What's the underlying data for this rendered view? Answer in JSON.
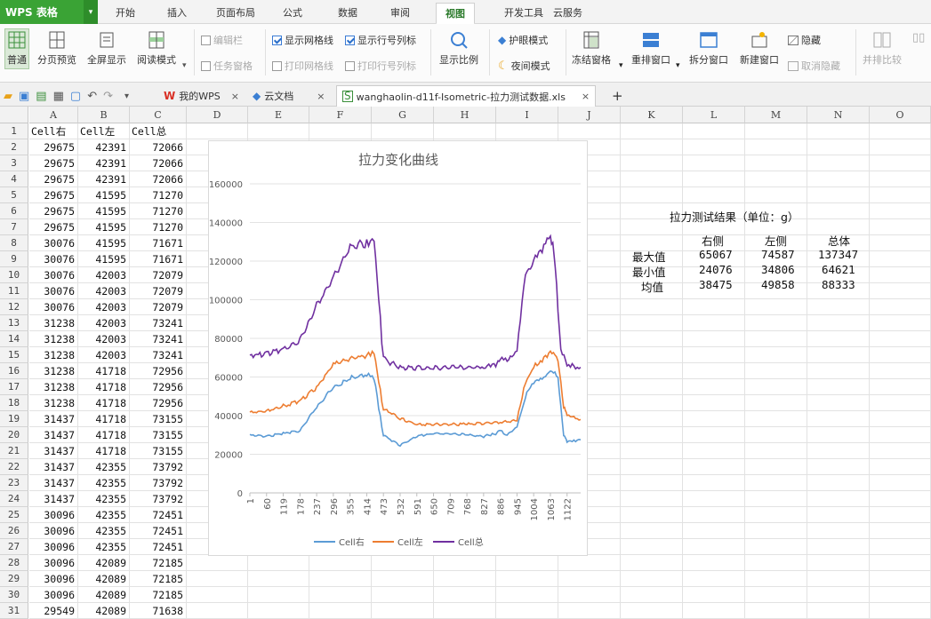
{
  "app": {
    "name": "WPS 表格"
  },
  "menu_tabs": [
    "开始",
    "插入",
    "页面布局",
    "公式",
    "数据",
    "审阅",
    "视图",
    "开发工具",
    "云服务"
  ],
  "active_menu_tab": "视图",
  "ribbon": {
    "normal": "普通",
    "page_break": "分页预览",
    "fullscreen": "全屏显示",
    "reading": "阅读模式",
    "edit_bar": "编辑栏",
    "task_pane": "任务窗格",
    "show_gridlines": "显示网格线",
    "print_gridlines": "打印网格线",
    "show_headers": "显示行号列标",
    "print_headers": "打印行号列标",
    "zoom": "显示比例",
    "eye_mode": "护眼模式",
    "night_mode": "夜间模式",
    "freeze": "冻结窗格",
    "rearrange": "重排窗口",
    "split": "拆分窗口",
    "new_window": "新建窗口",
    "hide": "隐藏",
    "unhide": "取消隐藏",
    "side_by_side": "并排比较"
  },
  "doc_tabs": {
    "my_wps": "我的WPS",
    "cloud_docs": "云文档",
    "file": "wanghaolin-d11f-Isometric-拉力测试数据.xls"
  },
  "columns": [
    "A",
    "B",
    "C",
    "D",
    "E",
    "F",
    "G",
    "H",
    "I",
    "J",
    "K",
    "L",
    "M",
    "N",
    "O"
  ],
  "header_row": [
    "Cell右",
    "Cell左",
    "Cell总"
  ],
  "rows": [
    [
      29675,
      42391,
      72066
    ],
    [
      29675,
      42391,
      72066
    ],
    [
      29675,
      42391,
      72066
    ],
    [
      29675,
      41595,
      71270
    ],
    [
      29675,
      41595,
      71270
    ],
    [
      29675,
      41595,
      71270
    ],
    [
      30076,
      41595,
      71671
    ],
    [
      30076,
      41595,
      71671
    ],
    [
      30076,
      42003,
      72079
    ],
    [
      30076,
      42003,
      72079
    ],
    [
      30076,
      42003,
      72079
    ],
    [
      31238,
      42003,
      73241
    ],
    [
      31238,
      42003,
      73241
    ],
    [
      31238,
      42003,
      73241
    ],
    [
      31238,
      41718,
      72956
    ],
    [
      31238,
      41718,
      72956
    ],
    [
      31238,
      41718,
      72956
    ],
    [
      31437,
      41718,
      73155
    ],
    [
      31437,
      41718,
      73155
    ],
    [
      31437,
      41718,
      73155
    ],
    [
      31437,
      42355,
      73792
    ],
    [
      31437,
      42355,
      73792
    ],
    [
      31437,
      42355,
      73792
    ],
    [
      30096,
      42355,
      72451
    ],
    [
      30096,
      42355,
      72451
    ],
    [
      30096,
      42355,
      72451
    ],
    [
      30096,
      42089,
      72185
    ],
    [
      30096,
      42089,
      72185
    ],
    [
      30096,
      42089,
      72185
    ],
    [
      29549,
      42089,
      71638
    ]
  ],
  "results": {
    "title": "拉力测试结果（单位：g）",
    "headers": [
      "右侧",
      "左侧",
      "总体"
    ],
    "rows": [
      {
        "label": "最大值",
        "values": [
          65067,
          74587,
          137347
        ]
      },
      {
        "label": "最小值",
        "values": [
          24076,
          34806,
          64621
        ]
      },
      {
        "label": "均值",
        "values": [
          38475,
          49858,
          88333
        ]
      }
    ]
  },
  "chart_data": {
    "type": "line",
    "title": "拉力变化曲线",
    "ylim": [
      0,
      160000
    ],
    "yticks": [
      0,
      20000,
      40000,
      60000,
      80000,
      100000,
      120000,
      140000,
      160000
    ],
    "xtick_labels": [
      "1",
      "60",
      "119",
      "178",
      "237",
      "296",
      "355",
      "414",
      "473",
      "532",
      "591",
      "650",
      "709",
      "768",
      "827",
      "886",
      "945",
      "1004",
      "1063",
      "1122"
    ],
    "x_range": [
      1,
      1170
    ],
    "legend_position": "bottom",
    "series": [
      {
        "name": "Cell右",
        "color": "#5b9bd5",
        "points": [
          [
            1,
            30000
          ],
          [
            60,
            29700
          ],
          [
            119,
            31000
          ],
          [
            178,
            32500
          ],
          [
            237,
            45000
          ],
          [
            296,
            55000
          ],
          [
            355,
            60000
          ],
          [
            414,
            62000
          ],
          [
            440,
            60000
          ],
          [
            473,
            30000
          ],
          [
            532,
            25000
          ],
          [
            591,
            29500
          ],
          [
            650,
            31000
          ],
          [
            709,
            31000
          ],
          [
            768,
            30500
          ],
          [
            827,
            29500
          ],
          [
            870,
            31000
          ],
          [
            886,
            33000
          ],
          [
            910,
            30000
          ],
          [
            945,
            35000
          ],
          [
            980,
            52000
          ],
          [
            1004,
            58000
          ],
          [
            1040,
            60000
          ],
          [
            1063,
            65000
          ],
          [
            1090,
            60000
          ],
          [
            1110,
            30000
          ],
          [
            1122,
            27000
          ],
          [
            1170,
            27500
          ]
        ]
      },
      {
        "name": "Cell左",
        "color": "#ed7d31",
        "points": [
          [
            1,
            42000
          ],
          [
            60,
            43000
          ],
          [
            119,
            45500
          ],
          [
            178,
            48000
          ],
          [
            237,
            55000
          ],
          [
            296,
            67000
          ],
          [
            355,
            70000
          ],
          [
            414,
            72000
          ],
          [
            440,
            73000
          ],
          [
            473,
            44000
          ],
          [
            532,
            39000
          ],
          [
            591,
            36000
          ],
          [
            650,
            35800
          ],
          [
            709,
            35800
          ],
          [
            768,
            36000
          ],
          [
            827,
            36200
          ],
          [
            886,
            37000
          ],
          [
            945,
            38000
          ],
          [
            975,
            58000
          ],
          [
            1004,
            66000
          ],
          [
            1040,
            70000
          ],
          [
            1063,
            74500
          ],
          [
            1090,
            70000
          ],
          [
            1110,
            45000
          ],
          [
            1122,
            41000
          ],
          [
            1170,
            38000
          ]
        ]
      },
      {
        "name": "Cell总",
        "color": "#7030a0",
        "points": [
          [
            1,
            72000
          ],
          [
            60,
            72500
          ],
          [
            119,
            75000
          ],
          [
            178,
            80000
          ],
          [
            237,
            98000
          ],
          [
            296,
            113000
          ],
          [
            355,
            128000
          ],
          [
            414,
            131000
          ],
          [
            440,
            133000
          ],
          [
            473,
            70000
          ],
          [
            532,
            65500
          ],
          [
            591,
            65500
          ],
          [
            650,
            65600
          ],
          [
            709,
            65600
          ],
          [
            768,
            65800
          ],
          [
            827,
            66000
          ],
          [
            870,
            66500
          ],
          [
            886,
            70000
          ],
          [
            910,
            70000
          ],
          [
            945,
            75000
          ],
          [
            975,
            115000
          ],
          [
            1004,
            122000
          ],
          [
            1040,
            128000
          ],
          [
            1063,
            137000
          ],
          [
            1080,
            120000
          ],
          [
            1100,
            75000
          ],
          [
            1122,
            67000
          ],
          [
            1170,
            65000
          ]
        ]
      }
    ]
  }
}
